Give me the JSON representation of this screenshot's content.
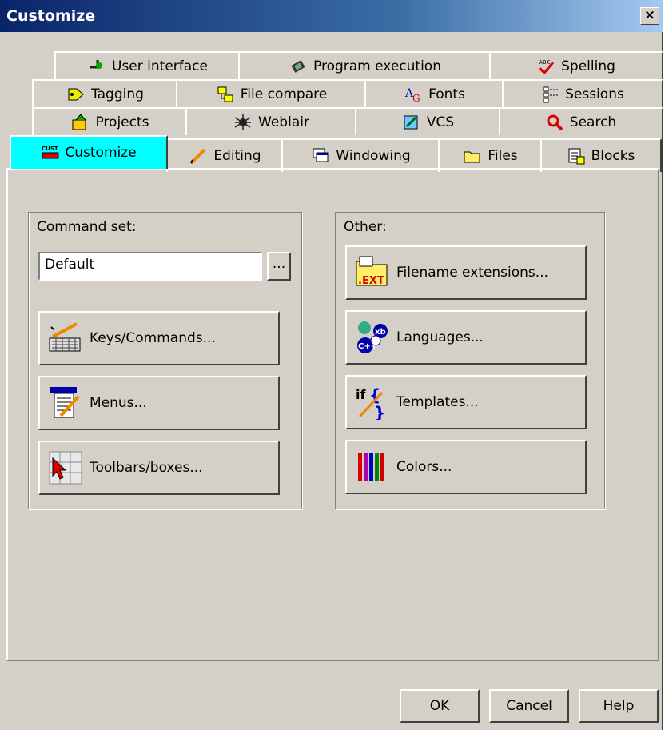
{
  "window": {
    "title": "Customize",
    "close_label": "×"
  },
  "tabs": {
    "row1": [
      {
        "label": "User interface",
        "icon": "pin-icon"
      },
      {
        "label": "Program execution",
        "icon": "chip-icon"
      },
      {
        "label": "Spelling",
        "icon": "spellcheck-icon"
      }
    ],
    "row2": [
      {
        "label": "Tagging",
        "icon": "tag-icon"
      },
      {
        "label": "File compare",
        "icon": "compare-icon"
      },
      {
        "label": "Fonts",
        "icon": "fonts-icon"
      },
      {
        "label": "Sessions",
        "icon": "sessions-icon"
      }
    ],
    "row3": [
      {
        "label": "Projects",
        "icon": "projects-icon"
      },
      {
        "label": "Weblair",
        "icon": "spider-icon"
      },
      {
        "label": "VCS",
        "icon": "vcs-icon"
      },
      {
        "label": "Search",
        "icon": "magnifier-icon"
      }
    ],
    "row4": [
      {
        "label": "Customize",
        "icon": "cust-icon",
        "active": true
      },
      {
        "label": "Editing",
        "icon": "pencil-icon"
      },
      {
        "label": "Windowing",
        "icon": "windows-icon"
      },
      {
        "label": "Files",
        "icon": "folder-icon"
      },
      {
        "label": "Blocks",
        "icon": "blocks-icon"
      }
    ]
  },
  "command_set": {
    "label": "Command set:",
    "value": "Default",
    "browse_label": "...",
    "buttons": {
      "keys": "Keys/Commands...",
      "menus": "Menus...",
      "toolbars": "Toolbars/boxes..."
    }
  },
  "other": {
    "label": "Other:",
    "buttons": {
      "filename_extensions": "Filename extensions...",
      "languages": "Languages...",
      "templates": "Templates...",
      "colors": "Colors..."
    }
  },
  "footer": {
    "ok": "OK",
    "cancel": "Cancel",
    "help": "Help"
  },
  "colors": {
    "active_tab": "#00ffff",
    "titlebar": "#0a246a",
    "face": "#d4d0c8"
  }
}
